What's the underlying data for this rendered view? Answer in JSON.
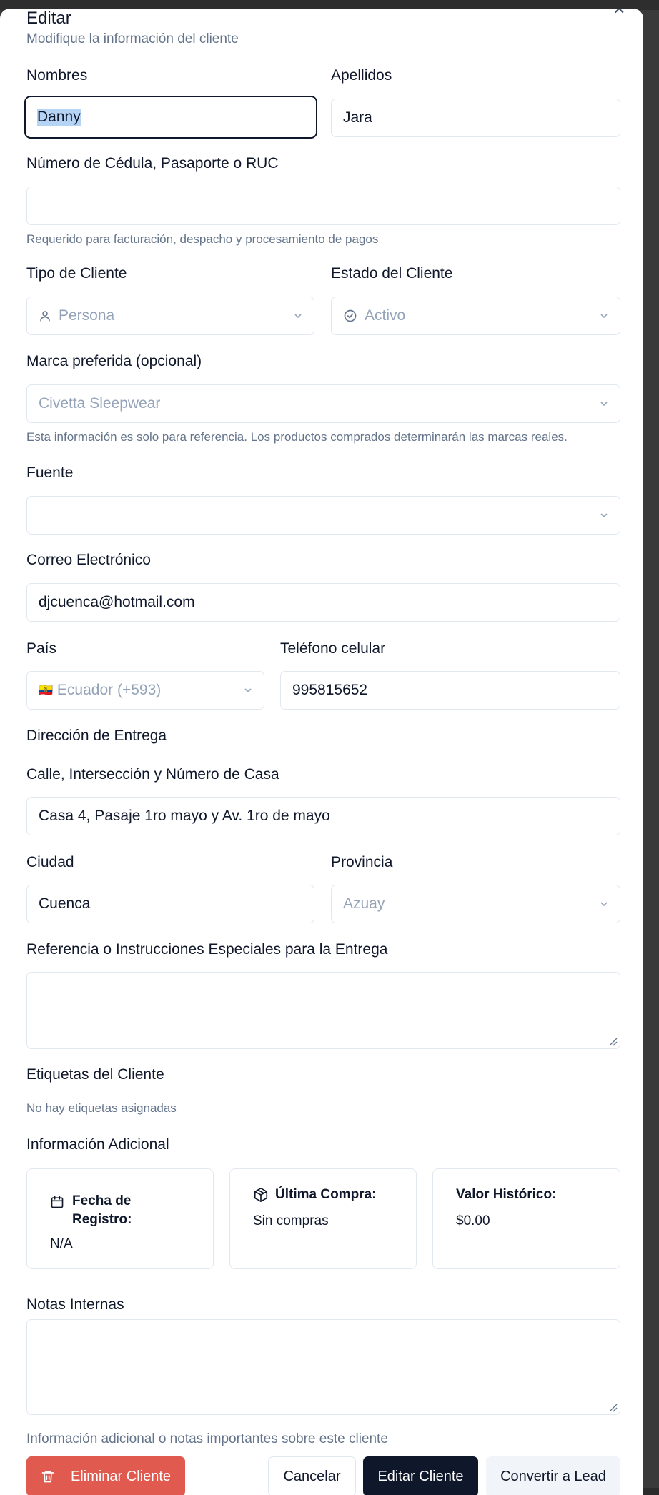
{
  "dialog": {
    "title": "Editar",
    "subtitle": "Modifique la información del cliente",
    "close_icon": "close-icon"
  },
  "fields": {
    "nombres": {
      "label": "Nombres",
      "value": "Danny"
    },
    "apellidos": {
      "label": "Apellidos",
      "value": "Jara"
    },
    "cedula": {
      "label": "Número de Cédula, Pasaporte o RUC",
      "value": "",
      "hint": "Requerido para facturación, despacho y procesamiento de pagos"
    },
    "tipo_cliente": {
      "label": "Tipo de Cliente",
      "value": "Persona",
      "icon": "user-icon"
    },
    "estado_cliente": {
      "label": "Estado del Cliente",
      "value": "Activo",
      "icon": "check-circle-icon"
    },
    "marca": {
      "label": "Marca preferida (opcional)",
      "value": "Civetta Sleepwear",
      "hint": "Esta información es solo para referencia. Los productos comprados determinarán las marcas reales."
    },
    "fuente": {
      "label": "Fuente",
      "value": ""
    },
    "correo": {
      "label": "Correo Electrónico",
      "value": "djcuenca@hotmail.com"
    },
    "pais": {
      "label": "País",
      "value": "Ecuador (+593)",
      "flag": "🇪🇨"
    },
    "telefono": {
      "label": "Teléfono celular",
      "value": "995815652"
    },
    "direccion_heading": "Dirección de Entrega",
    "calle": {
      "label": "Calle, Intersección y Número de Casa",
      "value": "Casa 4, Pasaje 1ro mayo y Av. 1ro de mayo"
    },
    "ciudad": {
      "label": "Ciudad",
      "value": "Cuenca"
    },
    "provincia": {
      "label": "Provincia",
      "value": "Azuay"
    },
    "referencia": {
      "label": "Referencia o Instrucciones Especiales para la Entrega",
      "value": ""
    },
    "etiquetas": {
      "label": "Etiquetas del Cliente",
      "empty": "No hay etiquetas asignadas"
    },
    "info_adicional": {
      "label": "Información Adicional",
      "cards": [
        {
          "title": "Fecha de Registro:",
          "value": "N/A",
          "icon": "calendar-icon"
        },
        {
          "title": "Última Compra:",
          "value": "Sin compras",
          "icon": "package-icon"
        },
        {
          "title": "Valor Histórico:",
          "value": "$0.00"
        }
      ]
    },
    "notas": {
      "label": "Notas Internas",
      "value": "",
      "hint": "Información adicional o notas importantes sobre este cliente"
    }
  },
  "actions": {
    "delete": "Eliminar Cliente",
    "cancel": "Cancelar",
    "submit": "Editar Cliente",
    "convert": "Convertir a Lead"
  },
  "colors": {
    "danger": "#e05a4f",
    "primary": "#0f172a",
    "border": "#e2e8f0",
    "muted": "#64748b"
  }
}
